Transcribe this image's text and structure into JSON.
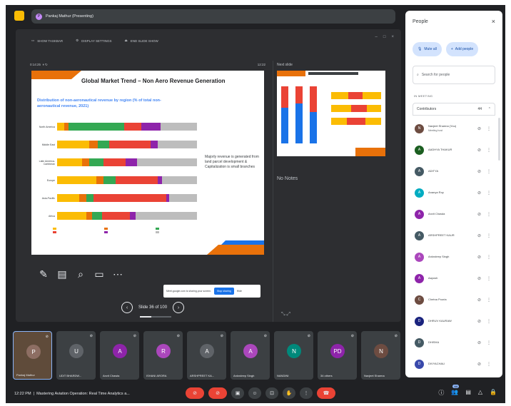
{
  "presenter_chip": "Pankaj Mathur (Presenting)",
  "present_toolbar": {
    "show_taskbar": "SHOW TASKBAR",
    "display_settings": "DISPLAY SETTINGS",
    "end_show": "END SLIDE SHOW"
  },
  "slide_header": {
    "timer": "0:14:25",
    "clock": "12:22"
  },
  "slide": {
    "title": "Global Market Trend – Non Aero Revenue Generation",
    "chart_title": "Distribution of non-aeronautical revenue by region (% of total non-aeronautical revenue, 2021)",
    "note": "Majorly revenue is generated from land parcel development & Capitalization is small branches"
  },
  "chart_data": {
    "type": "bar",
    "title": "Distribution of non-aeronautical revenue by region (% of total non-aeronautical revenue, 2021)",
    "categories": [
      "North America",
      "Middle East",
      "Latin America-Caribbean",
      "Europe",
      "Asia-Pacific",
      "Africa"
    ],
    "series": [
      {
        "color": "#fbbc04",
        "values": [
          5,
          23,
          18,
          28,
          16,
          21
        ]
      },
      {
        "color": "#e8710a",
        "values": [
          3,
          6,
          5,
          5,
          5,
          4
        ]
      },
      {
        "color": "#34a853",
        "values": [
          40,
          8,
          10,
          9,
          5,
          7
        ]
      },
      {
        "color": "#ea4335",
        "values": [
          12,
          30,
          16,
          30,
          52,
          20
        ]
      },
      {
        "color": "#8e24aa",
        "values": [
          14,
          5,
          8,
          3,
          2,
          4
        ]
      },
      {
        "color": "#bdbdbd",
        "values": [
          26,
          28,
          43,
          25,
          20,
          44
        ]
      }
    ]
  },
  "sharing_bar": {
    "text": "Meet.google.com is sharing your screen.",
    "stop": "Stop sharing",
    "hide": "Hide"
  },
  "slide_nav": {
    "label": "Slide 36 of 100",
    "progress": 0.36
  },
  "next_slide_label": "Next slide",
  "notes_label": "No Notes",
  "tiles": [
    {
      "name": "Pankaj Mathur",
      "initial": "P",
      "color": "#8d6e63",
      "active": true
    },
    {
      "name": "UDIT BHARDW...",
      "initial": "U",
      "color": "#5f6368"
    },
    {
      "name": "Anvit Chawla",
      "initial": "A",
      "color": "#8e24aa"
    },
    {
      "name": "ISHANI ARORA",
      "initial": "R",
      "color": "#ab47bc"
    },
    {
      "name": "ARSHPREET KA...",
      "initial": "A",
      "color": "#5f6368"
    },
    {
      "name": "Ankndeep Singh",
      "initial": "A",
      "color": "#ab47bc"
    },
    {
      "name": "NANDINI",
      "initial": "N",
      "color": "#00897b"
    },
    {
      "name": "34 others",
      "initial": "PD",
      "color": "#8e24aa"
    },
    {
      "name": "Navjeet Sharma",
      "initial": "N",
      "color": "#6d4c41"
    }
  ],
  "bottombar": {
    "time": "12:22 PM",
    "title": "Mastering Aviation Operation: Real Time Analytics a..."
  },
  "people": {
    "title": "People",
    "mute_all": "Mute all",
    "add_people": "Add people",
    "search_placeholder": "Search for people",
    "in_meeting": "IN MEETING",
    "contributors": "Contributors",
    "count": "44",
    "list": [
      {
        "name": "Navjeet Sharma (You)",
        "sub": "Meeting host",
        "initial": "N",
        "color": "#6d4c41"
      },
      {
        "name": "AADHYA THAKUR",
        "sub": "",
        "initial": "A",
        "color": "#1b5e20"
      },
      {
        "name": "ADITYA",
        "sub": "",
        "initial": "A",
        "color": "#455a64"
      },
      {
        "name": "Ananya Roy",
        "sub": "",
        "initial": "A",
        "color": "#00acc1"
      },
      {
        "name": "Anvit Chawla",
        "sub": "",
        "initial": "A",
        "color": "#8e24aa"
      },
      {
        "name": "ARSHPREET KAUR",
        "sub": "",
        "initial": "A",
        "color": "#455a64"
      },
      {
        "name": "Ankndeep Singh",
        "sub": "",
        "initial": "A",
        "color": "#ab47bc"
      },
      {
        "name": "Aayush",
        "sub": "",
        "initial": "A",
        "color": "#8e24aa"
      },
      {
        "name": "Chetna Pooria",
        "sub": "",
        "initial": "C",
        "color": "#6d4c41"
      },
      {
        "name": "DHRUV KAURAW",
        "sub": "",
        "initial": "D",
        "color": "#1a237e"
      },
      {
        "name": "DHISHA",
        "sub": "",
        "initial": "D",
        "color": "#455a64"
      },
      {
        "name": "DIVYACHAU",
        "sub": "",
        "initial": "D",
        "color": "#3949ab"
      }
    ]
  }
}
